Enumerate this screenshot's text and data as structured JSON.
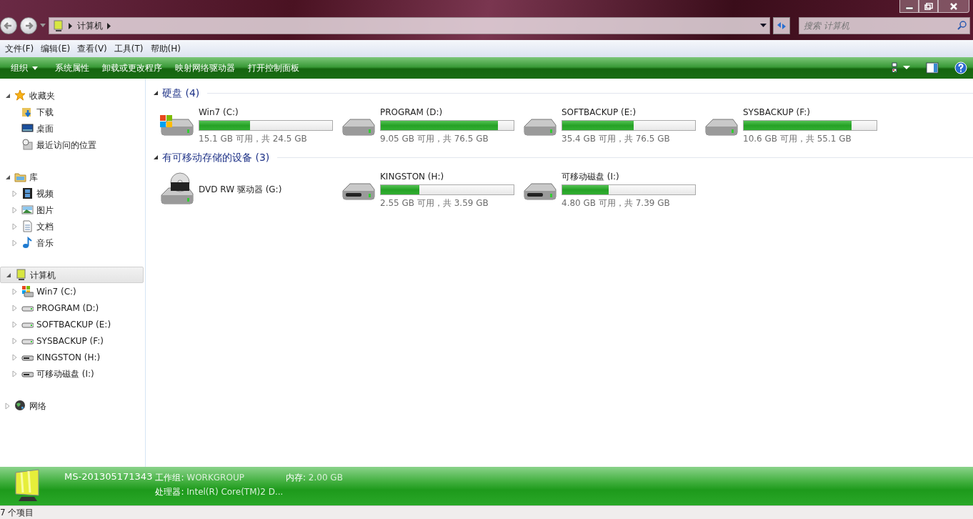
{
  "address": {
    "crumbs": [
      "计算机"
    ]
  },
  "search": {
    "placeholder": "搜索 计算机"
  },
  "menu": [
    "文件(F)",
    "编辑(E)",
    "查看(V)",
    "工具(T)",
    "帮助(H)"
  ],
  "toolbar": [
    {
      "label": "组织",
      "dropdown": true
    },
    {
      "label": "系统属性",
      "dropdown": false
    },
    {
      "label": "卸载或更改程序",
      "dropdown": false
    },
    {
      "label": "映射网络驱动器",
      "dropdown": false
    },
    {
      "label": "打开控制面板",
      "dropdown": false
    }
  ],
  "sidebar": {
    "items": [
      {
        "label": "收藏夹",
        "kind": "star",
        "expanded": true,
        "selected": false,
        "children": [
          {
            "label": "下载",
            "kind": "download"
          },
          {
            "label": "桌面",
            "kind": "desktop"
          },
          {
            "label": "最近访问的位置",
            "kind": "recent"
          }
        ]
      },
      {
        "label": "库",
        "kind": "library",
        "expanded": true,
        "selected": false,
        "children": [
          {
            "label": "视频",
            "kind": "video",
            "expanded": false
          },
          {
            "label": "图片",
            "kind": "picture",
            "expanded": false
          },
          {
            "label": "文档",
            "kind": "document",
            "expanded": false
          },
          {
            "label": "音乐",
            "kind": "music",
            "expanded": false
          }
        ]
      },
      {
        "label": "计算机",
        "kind": "computer",
        "expanded": true,
        "selected": true,
        "children": [
          {
            "label": "Win7 (C:)",
            "kind": "system",
            "expanded": false
          },
          {
            "label": "PROGRAM (D:)",
            "kind": "hdd",
            "expanded": false
          },
          {
            "label": "SOFTBACKUP (E:)",
            "kind": "hdd",
            "expanded": false
          },
          {
            "label": "SYSBACKUP (F:)",
            "kind": "hdd",
            "expanded": false
          },
          {
            "label": "KINGSTON (H:)",
            "kind": "removable",
            "expanded": false
          },
          {
            "label": "可移动磁盘 (I:)",
            "kind": "removable",
            "expanded": false
          }
        ]
      },
      {
        "label": "网络",
        "kind": "network",
        "expanded": false,
        "selected": false
      }
    ]
  },
  "groups": [
    {
      "title": "硬盘 (4)",
      "expanded": true,
      "drives": [
        {
          "name": "Win7 (C:)",
          "kind": "system",
          "level": 0.38,
          "space": "15.1 GB 可用，共 24.5 GB"
        },
        {
          "name": "PROGRAM (D:)",
          "kind": "hdd",
          "level": 0.88,
          "space": "9.05 GB 可用，共 76.5 GB"
        },
        {
          "name": "SOFTBACKUP (E:)",
          "kind": "hdd",
          "level": 0.54,
          "space": "35.4 GB 可用，共 76.5 GB"
        },
        {
          "name": "SYSBACKUP (F:)",
          "kind": "hdd",
          "level": 0.81,
          "space": "10.6 GB 可用，共 55.1 GB"
        }
      ]
    },
    {
      "title": "有可移动存储的设备 (3)",
      "expanded": true,
      "drives": [
        {
          "name": "DVD RW 驱动器 (G:)",
          "kind": "dvd"
        },
        {
          "name": "KINGSTON (H:)",
          "kind": "removable",
          "level": 0.29,
          "space": "2.55 GB 可用，共 3.59 GB"
        },
        {
          "name": "可移动磁盘 (I:)",
          "kind": "removable",
          "level": 0.35,
          "space": "4.80 GB 可用，共 7.39 GB"
        }
      ]
    }
  ],
  "details": {
    "name": "MS-201305171343",
    "fields": [
      {
        "label": "工作组:",
        "value": "WORKGROUP"
      },
      {
        "label": "内存:",
        "value": "2.00 GB"
      },
      {
        "label": "处理器:",
        "value": "Intel(R) Core(TM)2 D..."
      }
    ]
  },
  "status_bar": {
    "text": "7 个项目"
  }
}
